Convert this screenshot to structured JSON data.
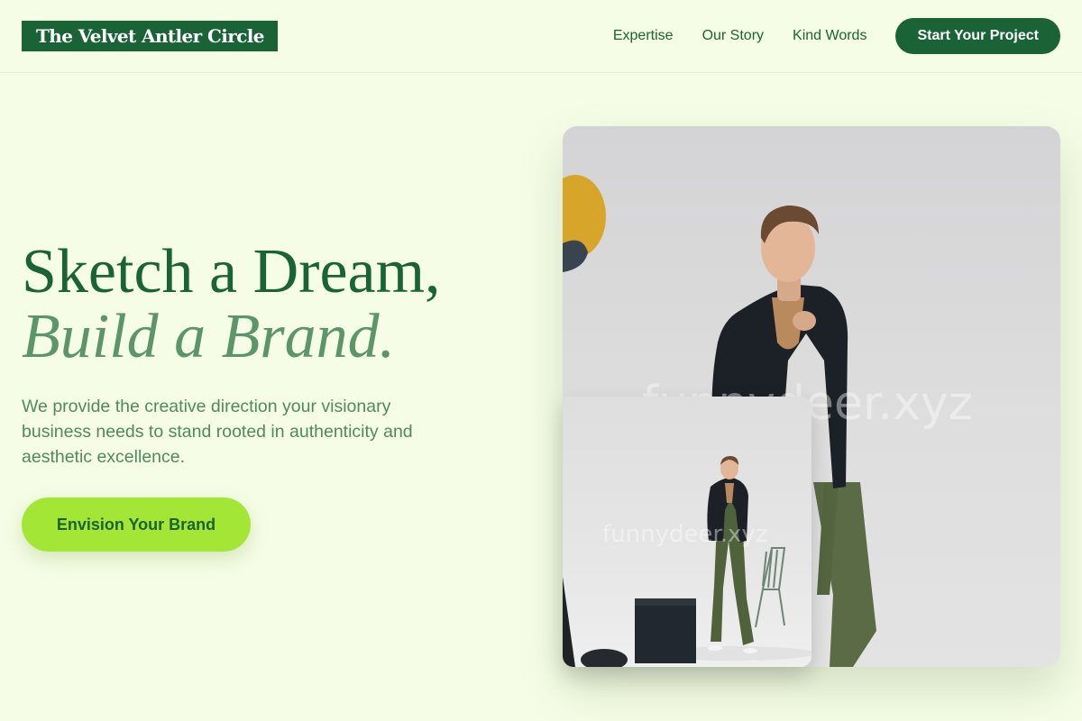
{
  "brand": {
    "name": "The Velvet Antler Circle"
  },
  "nav": {
    "links": [
      "Expertise",
      "Our Story",
      "Kind Words"
    ],
    "cta_label": "Start Your Project"
  },
  "hero": {
    "headline_line1": "Sketch a Dream,",
    "headline_line2": "Build a Brand.",
    "subtext": "We provide the creative direction your visionary business needs to stand rooted in authenticity and aesthetic excellence.",
    "cta_label": "Envision Your Brand"
  },
  "images": {
    "watermark": "funnydeer.xyz"
  },
  "colors": {
    "background": "#f5fde6",
    "primary": "#1a6337",
    "accent_muted": "#5c9668",
    "cta_lime": "#a3e635"
  }
}
